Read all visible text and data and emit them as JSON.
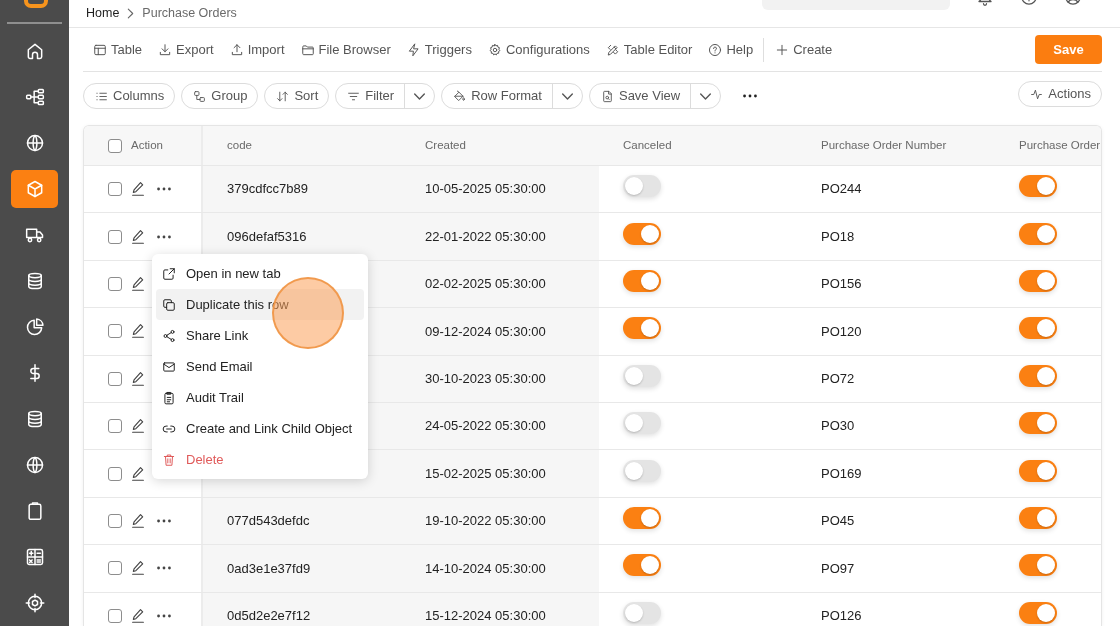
{
  "sidebar": {
    "items": [
      {
        "selected": false
      },
      {
        "selected": false
      },
      {
        "selected": false
      },
      {
        "selected": true
      },
      {
        "selected": false
      },
      {
        "selected": false
      },
      {
        "selected": false
      },
      {
        "selected": false
      },
      {
        "selected": false
      },
      {
        "selected": false
      },
      {
        "selected": false
      },
      {
        "selected": false
      },
      {
        "selected": false
      }
    ]
  },
  "breadcrumb": [
    {
      "label": "Home",
      "current": false
    },
    {
      "label": "Purchase Orders",
      "current": true
    }
  ],
  "toolbar": {
    "items": [
      "Table",
      "Export",
      "Import",
      "File Browser",
      "Triggers",
      "Configurations",
      "Table Editor",
      "Help"
    ],
    "create": "Create",
    "save": "Save"
  },
  "view_bar": {
    "buttons": [
      {
        "label": "Columns",
        "dropdown": false
      },
      {
        "label": "Group",
        "dropdown": false
      },
      {
        "label": "Sort",
        "dropdown": false
      },
      {
        "label": "Filter",
        "dropdown": true
      },
      {
        "label": "Row Format",
        "dropdown": true
      },
      {
        "label": "Save View",
        "dropdown": true
      }
    ],
    "actions": "Actions"
  },
  "table": {
    "all_checked": false,
    "columns": [
      "Action",
      "code",
      "Created",
      "Canceled",
      "Purchase Order Number",
      "Purchase Order"
    ],
    "rows": [
      {
        "checked": false,
        "code": "379cdfcc7b89",
        "created": "10-05-2025 05:30:00",
        "canceled": false,
        "po_number": "PO244",
        "purchase_order": true
      },
      {
        "checked": false,
        "code": "096defaf5316",
        "created": "22-01-2022 05:30:00",
        "canceled": true,
        "po_number": "PO18",
        "purchase_order": true
      },
      {
        "checked": false,
        "created": "02-02-2025 05:30:00",
        "canceled": true,
        "po_number": "PO156",
        "purchase_order": true
      },
      {
        "checked": false,
        "created": "09-12-2024 05:30:00",
        "canceled": true,
        "po_number": "PO120",
        "purchase_order": true
      },
      {
        "checked": false,
        "created": "30-10-2023 05:30:00",
        "canceled": false,
        "po_number": "PO72",
        "purchase_order": true
      },
      {
        "checked": false,
        "created": "24-05-2022 05:30:00",
        "canceled": false,
        "po_number": "PO30",
        "purchase_order": true
      },
      {
        "checked": false,
        "created": "15-02-2025 05:30:00",
        "canceled": false,
        "po_number": "PO169",
        "purchase_order": true
      },
      {
        "checked": false,
        "code": "077d543defdc",
        "created": "19-10-2022 05:30:00",
        "canceled": true,
        "po_number": "PO45",
        "purchase_order": true
      },
      {
        "checked": false,
        "code": "0ad3e1e37fd9",
        "created": "14-10-2024 05:30:00",
        "canceled": true,
        "po_number": "PO97",
        "purchase_order": true
      },
      {
        "checked": false,
        "code": "0d5d2e2e7f12",
        "created": "15-12-2024 05:30:00",
        "canceled": false,
        "po_number": "PO126",
        "purchase_order": true
      }
    ]
  },
  "context_menu": {
    "items": [
      {
        "label": "Open in new tab",
        "kind": "default",
        "highlighted": false
      },
      {
        "label": "Duplicate this row",
        "kind": "default",
        "highlighted": true
      },
      {
        "label": "Share Link",
        "kind": "default",
        "highlighted": false
      },
      {
        "label": "Send Email",
        "kind": "default",
        "highlighted": false
      },
      {
        "label": "Audit Trail",
        "kind": "default",
        "highlighted": false
      },
      {
        "label": "Create and Link Child Object",
        "kind": "default",
        "highlighted": false
      },
      {
        "label": "Delete",
        "kind": "danger",
        "highlighted": false
      }
    ]
  }
}
